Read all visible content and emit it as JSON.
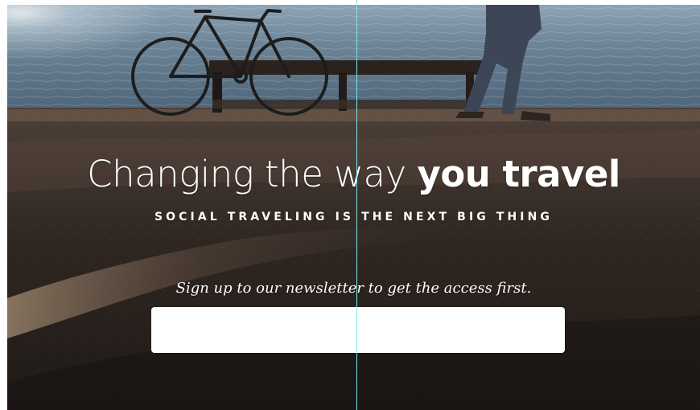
{
  "hero": {
    "headline_regular": "Changing the way",
    "headline_bold": "you travel",
    "subheadline": "SOCIAL TRAVELING IS THE NEXT BIG THING",
    "tagline": "Sign up to our newsletter to get the access first."
  },
  "newsletter": {
    "email_value": "",
    "placeholder": ""
  },
  "colors": {
    "guide_line": "#79e7e8",
    "text": "#ffffff",
    "input_background": "#ffffff"
  }
}
